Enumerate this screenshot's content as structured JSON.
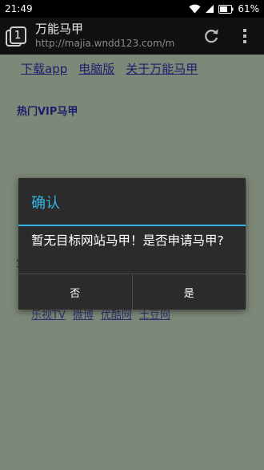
{
  "status_bar": {
    "time": "21:49",
    "battery": "61%"
  },
  "app_bar": {
    "tab_count": "1",
    "title": "万能马甲",
    "url": "http://majia.wndd123.com/m"
  },
  "page": {
    "top_links": [
      "下载app",
      "电脑版",
      "关于万能马甲"
    ],
    "section_heading": "热门VIP马甲",
    "site_links": [
      "乐视TV",
      "微博",
      "优酷网",
      "土豆网"
    ],
    "partial_glyph": "宝"
  },
  "dialog": {
    "title": "确认",
    "message": "暂无目标网站马甲！是否申请马甲?",
    "negative_label": "否",
    "positive_label": "是"
  },
  "colors": {
    "accent": "#33b5e5",
    "dialog_bg": "#2b2b2b",
    "link": "#1a1f6b"
  }
}
